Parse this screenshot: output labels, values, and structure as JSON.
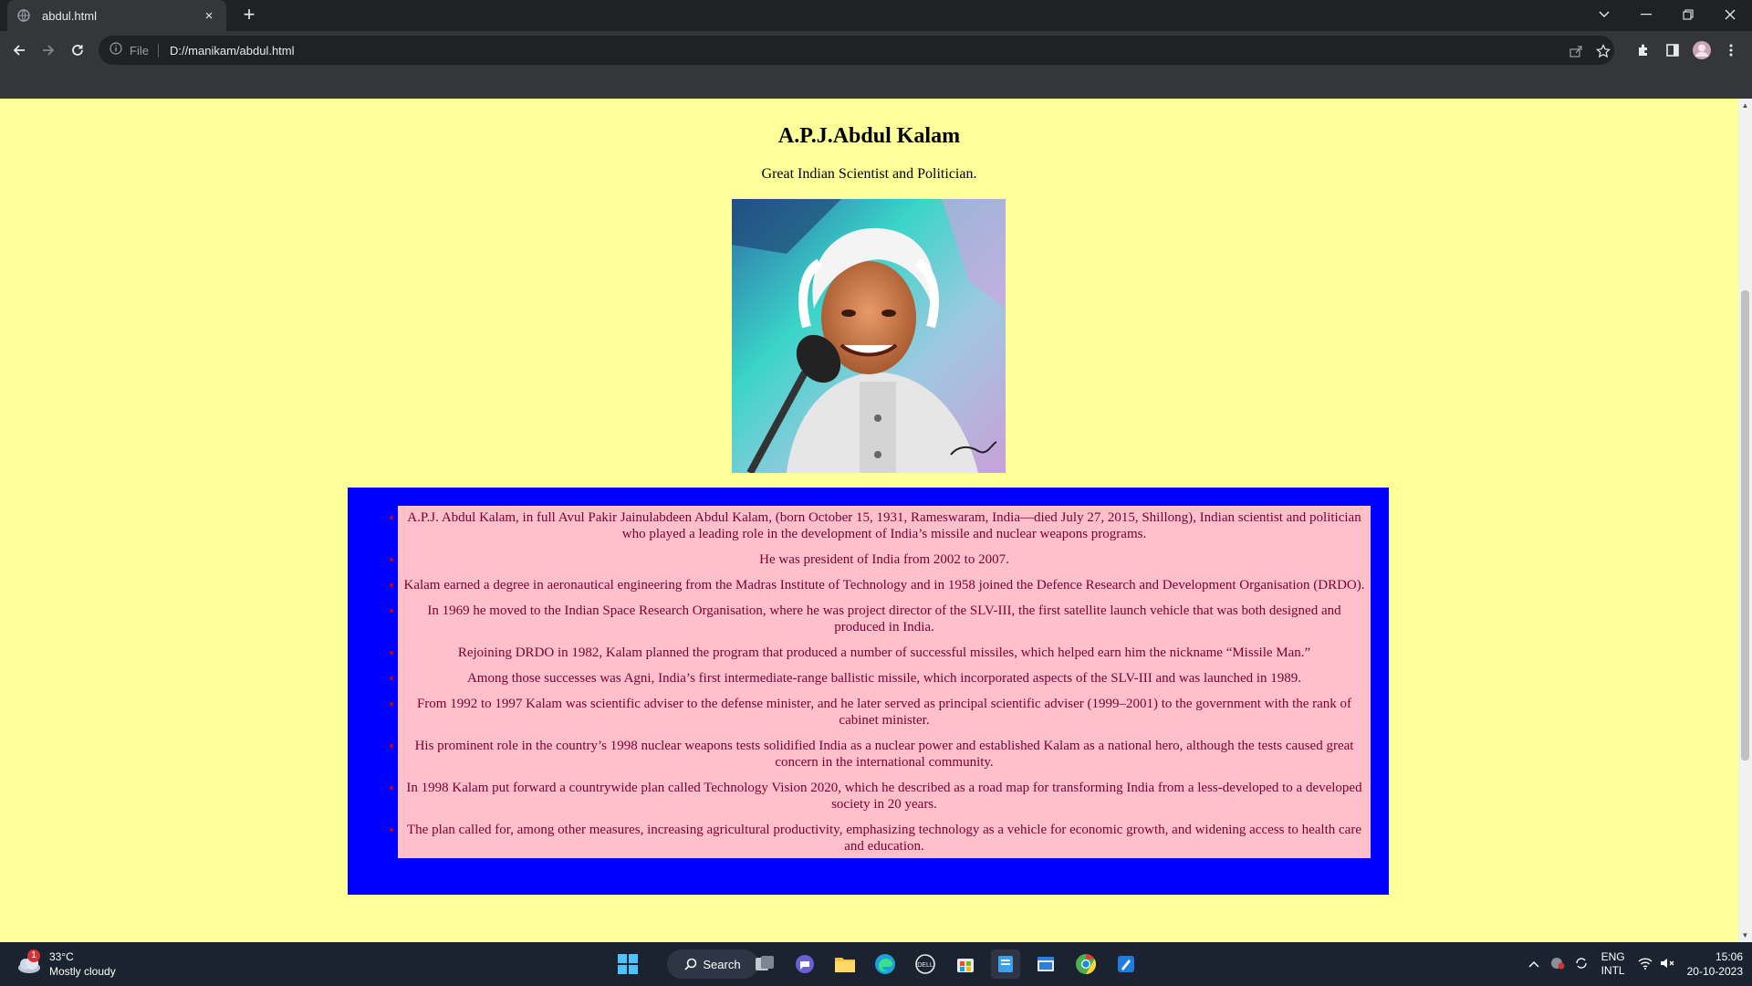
{
  "browser": {
    "tab_title": "abdul.html",
    "tab_close": "×",
    "new_tab": "+",
    "address_scheme": "File",
    "address_url": "D://manikam/abdul.html"
  },
  "page": {
    "title": "A.P.J.Abdul Kalam",
    "subtitle": "Great Indian Scientist and Politician.",
    "facts": [
      "A.P.J. Abdul Kalam, in full Avul Pakir Jainulabdeen Abdul Kalam, (born October 15, 1931, Rameswaram, India—died July 27, 2015, Shillong), Indian scientist and politician who played a leading role in the development of India’s missile and nuclear weapons programs.",
      "He was president of India from 2002 to 2007.",
      "Kalam earned a degree in aeronautical engineering from the Madras Institute of Technology and in 1958 joined the Defence Research and Development Organisation (DRDO).",
      "In 1969 he moved to the Indian Space Research Organisation, where he was project director of the SLV-III, the first satellite launch vehicle that was both designed and produced in India.",
      "Rejoining DRDO in 1982, Kalam planned the program that produced a number of successful missiles, which helped earn him the nickname “Missile Man.”",
      "Among those successes was Agni, India’s first intermediate-range ballistic missile, which incorporated aspects of the SLV-III and was launched in 1989.",
      "From 1992 to 1997 Kalam was scientific adviser to the defense minister, and he later served as principal scientific adviser (1999–2001) to the government with the rank of cabinet minister.",
      "His prominent role in the country’s 1998 nuclear weapons tests solidified India as a nuclear power and established Kalam as a national hero, although the tests caused great concern in the international community.",
      "In 1998 Kalam put forward a countrywide plan called Technology Vision 2020, which he described as a road map for transforming India from a less-developed to a developed society in 20 years.",
      "The plan called for, among other measures, increasing agricultural productivity, emphasizing technology as a vehicle for economic growth, and widening access to health care and education."
    ]
  },
  "taskbar": {
    "weather_temp": "33°C",
    "weather_desc": "Mostly cloudy",
    "weather_badge": "1",
    "search_label": "Search",
    "lang_line1": "ENG",
    "lang_line2": "INTL",
    "time": "15:06",
    "date": "20-10-2023"
  },
  "colors": {
    "page_background": "#ffff99",
    "facts_border": "#0000ff",
    "facts_background": "#ffc0cb",
    "bullet": "#cc0000"
  }
}
